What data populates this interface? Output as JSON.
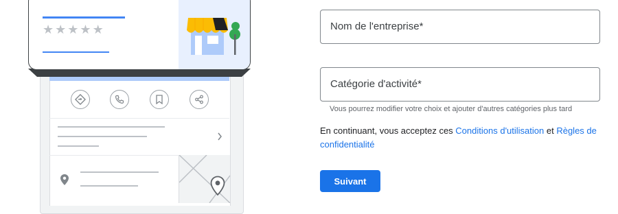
{
  "form": {
    "business_name_label": "Nom de l'entreprise*",
    "category_label": "Catégorie d'activité*",
    "category_hint": "Vous pourrez modifier votre choix et ajouter d'autres catégories plus tard",
    "terms_prefix": "En continuant, vous acceptez ces ",
    "terms_link": "Conditions d'utilisation",
    "terms_and": " et ",
    "privacy_link": "Règles de confidentialité",
    "next_button": "Suivant"
  },
  "illustration": {
    "rating_stars": 5,
    "icons": [
      "directions-icon",
      "phone-icon",
      "bookmark-icon",
      "share-icon",
      "chevron-right-icon",
      "location-pin-icon",
      "map-pin-icon",
      "storefront-icon"
    ]
  },
  "colors": {
    "accent": "#1a73e8",
    "awning": "#fbbc04",
    "store_wall": "#aecbfa",
    "tree": "#34a853"
  }
}
